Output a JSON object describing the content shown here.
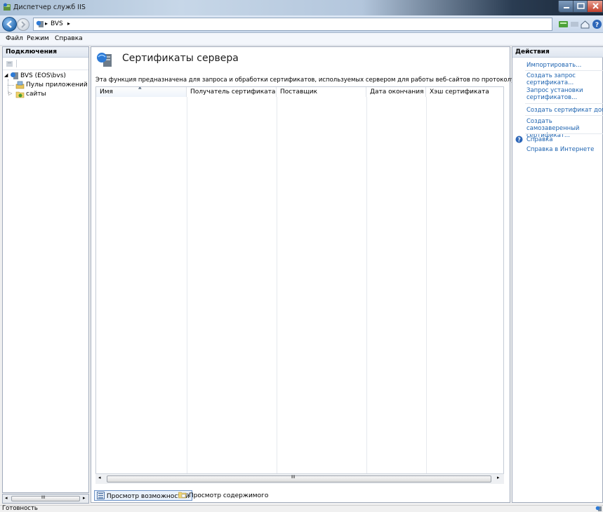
{
  "window": {
    "title": "Диспетчер служб IIS",
    "controls": {
      "minimize": "–",
      "maximize": "□",
      "close": "x"
    }
  },
  "address": {
    "crumbs": [
      "BVS"
    ],
    "separator": "▸"
  },
  "menu": {
    "items": [
      "Файл",
      "Режим",
      "Справка"
    ]
  },
  "connections": {
    "header": "Подключения",
    "tree": [
      {
        "label": "BVS (EOS\\bvs)",
        "level": 0,
        "expanded": true
      },
      {
        "label": "Пулы приложений",
        "level": 1
      },
      {
        "label": "сайты",
        "level": 1,
        "expanded": false
      }
    ],
    "scroll_label": "III"
  },
  "main": {
    "title": "Сертификаты сервера",
    "description": "Эта функция предназначена для запроса и обработки сертификатов, используемых сервером для работы веб-сайтов по протоколу SSL.",
    "columns": [
      "Имя",
      "Получатель сертификата",
      "Поставщик",
      "Дата окончания",
      "Хэш сертификата"
    ],
    "rows": [],
    "scroll_label": "III",
    "view_tabs": [
      {
        "label": "Просмотр возможностей",
        "active": true
      },
      {
        "label": "Просмотр содержимого",
        "active": false
      }
    ]
  },
  "actions": {
    "header": "Действия",
    "items": [
      {
        "label": "Импортировать...",
        "enabled": true
      },
      {
        "label": "Создать запрос сертификата...",
        "enabled": true
      },
      {
        "label": "Запрос установки сертификатов...",
        "enabled": true
      },
      {
        "label": "Создать сертификат домена...",
        "enabled": true
      },
      {
        "label": "Создать самозаверенный сертификат...",
        "enabled": true
      },
      {
        "label": "Справка",
        "enabled": true
      },
      {
        "label": "Справка в Интернете",
        "enabled": true
      }
    ]
  },
  "status": {
    "text": "Готовность"
  },
  "colors": {
    "link": "#1d63b0",
    "accent": "#2d6fb3"
  }
}
